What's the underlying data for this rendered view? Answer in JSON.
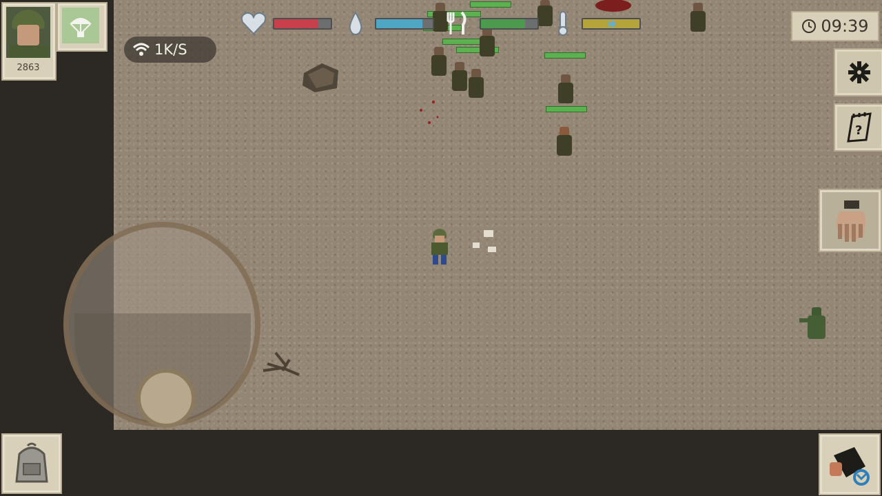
{
  "player": {
    "score": "2863",
    "avatar_icon": "soldier-avatar-icon"
  },
  "supply": {
    "icon": "parachute-icon"
  },
  "network": {
    "speed": "1K/S",
    "icon": "wifi-icon"
  },
  "stats": {
    "health": {
      "icon": "heart-icon",
      "level": 0.78,
      "color": "#c8404b"
    },
    "thirst": {
      "icon": "water-drop-icon",
      "level": 0.82,
      "color": "#4fa6c4"
    },
    "hunger": {
      "icon": "fork-knife-icon",
      "level": 0.78,
      "color": "#4c9a4e"
    },
    "temperature": {
      "icon": "thermometer-icon",
      "level": 1.0,
      "color": "#b4a43a"
    }
  },
  "clock": {
    "time": "09:39",
    "icon": "clock-icon"
  },
  "buttons": {
    "settings": "gear-icon",
    "quests": "notebook-icon",
    "interact": "hand-icon",
    "inventory": "backpack-icon",
    "weapon": "weapon-swap-icon"
  },
  "colors": {
    "ground": "#948674",
    "panel": "#d8d0b8",
    "background": "#2c2823"
  }
}
